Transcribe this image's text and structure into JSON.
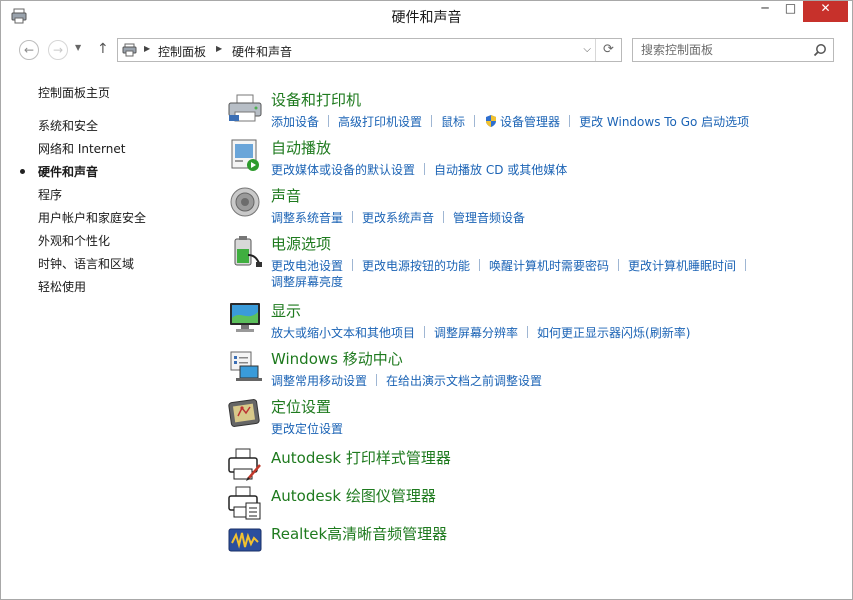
{
  "window": {
    "title": "硬件和声音",
    "minimize_label": "─",
    "maximize_label": "□",
    "close_label": "✕"
  },
  "nav": {
    "back_glyph": "←",
    "forward_glyph": "→",
    "recent_glyph": "▼",
    "up_glyph": "↑",
    "breadcrumbs": [
      "控制面板",
      "硬件和声音"
    ],
    "breadcrumb_sep": "▶",
    "dropdown_glyph": "⌵",
    "refresh_glyph": "⟳",
    "search_placeholder": "搜索控制面板"
  },
  "sidebar": {
    "home": "控制面板主页",
    "items": [
      {
        "label": "系统和安全",
        "active": false
      },
      {
        "label": "网络和 Internet",
        "active": false
      },
      {
        "label": "硬件和声音",
        "active": true
      },
      {
        "label": "程序",
        "active": false
      },
      {
        "label": "用户帐户和家庭安全",
        "active": false
      },
      {
        "label": "外观和个性化",
        "active": false
      },
      {
        "label": "时钟、语言和区域",
        "active": false
      },
      {
        "label": "轻松使用",
        "active": false
      }
    ]
  },
  "categories": {
    "devices": {
      "title": "设备和打印机",
      "links": [
        "添加设备",
        "高级打印机设置",
        "鼠标",
        "设备管理器",
        "更改 Windows To Go 启动选项"
      ],
      "icon": "printer-icon"
    },
    "autoplay": {
      "title": "自动播放",
      "links": [
        "更改媒体或设备的默认设置",
        "自动播放 CD 或其他媒体"
      ],
      "icon": "autoplay-icon"
    },
    "sound": {
      "title": "声音",
      "links": [
        "调整系统音量",
        "更改系统声音",
        "管理音频设备"
      ],
      "icon": "speaker-icon"
    },
    "power": {
      "title": "电源选项",
      "links": [
        "更改电池设置",
        "更改电源按钮的功能",
        "唤醒计算机时需要密码",
        "更改计算机睡眠时间",
        "调整屏幕亮度"
      ],
      "icon": "battery-icon"
    },
    "display": {
      "title": "显示",
      "links": [
        "放大或缩小文本和其他项目",
        "调整屏幕分辨率",
        "如何更正显示器闪烁(刷新率)"
      ],
      "icon": "monitor-icon"
    },
    "mobility": {
      "title": "Windows 移动中心",
      "links": [
        "调整常用移动设置",
        "在给出演示文档之前调整设置"
      ],
      "icon": "laptop-icon"
    },
    "location": {
      "title": "定位设置",
      "links": [
        "更改定位设置"
      ],
      "icon": "location-icon"
    },
    "autodesk_print": {
      "title": "Autodesk 打印样式管理器",
      "icon": "print-style-icon"
    },
    "autodesk_plotter": {
      "title": "Autodesk 绘图仪管理器",
      "icon": "plotter-icon"
    },
    "realtek": {
      "title": "Realtek高清晰音频管理器",
      "icon": "realtek-audio-icon"
    }
  },
  "colors": {
    "category_title": "#1e7a1e",
    "link": "#1b63b5",
    "close_button": "#c7312b"
  }
}
